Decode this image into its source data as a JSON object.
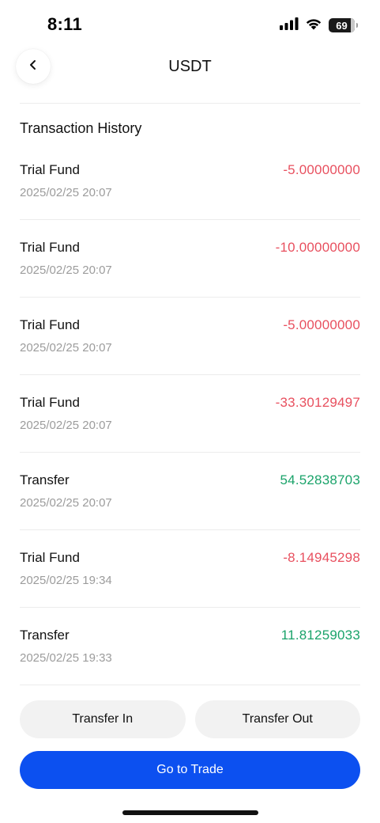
{
  "status_bar": {
    "time": "8:11",
    "battery": "69",
    "icons": [
      "signal-icon",
      "wifi-icon",
      "battery-icon"
    ]
  },
  "header": {
    "title": "USDT",
    "back_icon": "chevron-left-icon"
  },
  "section": {
    "title": "Transaction History"
  },
  "transactions": [
    {
      "label": "Trial Fund",
      "date": "2025/02/25 20:07",
      "amount": "-5.00000000",
      "direction": "negative"
    },
    {
      "label": "Trial Fund",
      "date": "2025/02/25 20:07",
      "amount": "-10.00000000",
      "direction": "negative"
    },
    {
      "label": "Trial Fund",
      "date": "2025/02/25 20:07",
      "amount": "-5.00000000",
      "direction": "negative"
    },
    {
      "label": "Trial Fund",
      "date": "2025/02/25 20:07",
      "amount": "-33.30129497",
      "direction": "negative"
    },
    {
      "label": "Transfer",
      "date": "2025/02/25 20:07",
      "amount": "54.52838703",
      "direction": "positive"
    },
    {
      "label": "Trial Fund",
      "date": "2025/02/25 19:34",
      "amount": "-8.14945298",
      "direction": "negative"
    },
    {
      "label": "Transfer",
      "date": "2025/02/25 19:33",
      "amount": "11.81259033",
      "direction": "positive"
    }
  ],
  "actions": {
    "transfer_in": "Transfer In",
    "transfer_out": "Transfer Out",
    "go_to_trade": "Go to Trade"
  },
  "colors": {
    "negative": "#e8505f",
    "positive": "#1aa36a",
    "primary": "#0c50f0"
  }
}
